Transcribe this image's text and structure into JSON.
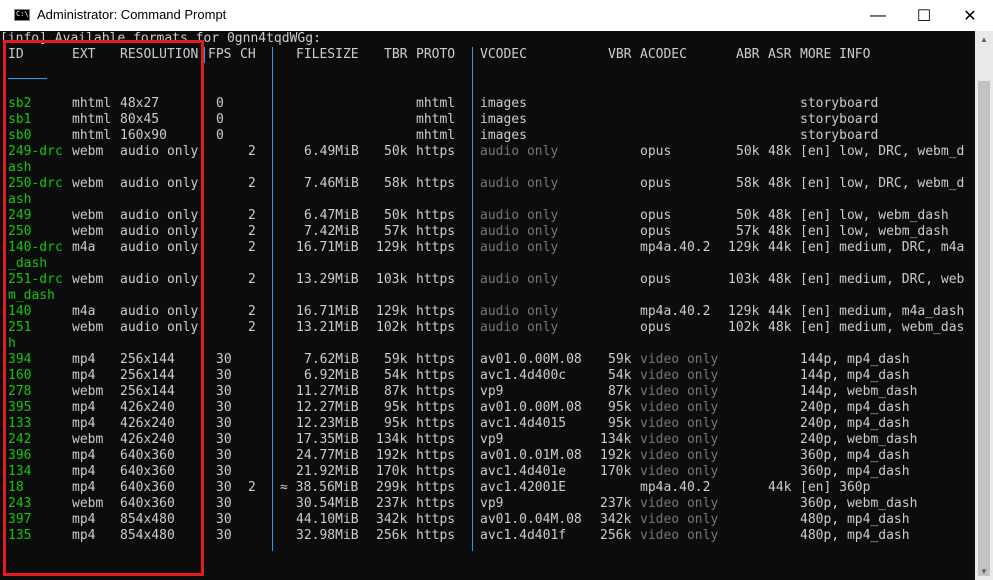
{
  "window": {
    "title": "Administrator: Command Prompt",
    "icon_label": "C:\\",
    "minimize": "—",
    "maximize": "☐",
    "close": "✕"
  },
  "console": {
    "info_line": "[info] Available formats for 0gnn4tqdWGg:",
    "headers": {
      "id": "ID",
      "ext": "EXT",
      "resolution": "RESOLUTION",
      "fps": "FPS",
      "ch": "CH",
      "filesize": "FILESIZE",
      "tbr": "TBR",
      "proto": "PROTO",
      "vcodec": "VCODEC",
      "vbr": "VBR",
      "acodec": "ACODEC",
      "abr": "ABR",
      "asr": "ASR",
      "more_info": "MORE INFO"
    },
    "dash_line": "─────",
    "rows": [
      {
        "id": "sb2",
        "ext": "mhtml",
        "res": "48x27",
        "fps": "0",
        "ch": "",
        "size": "",
        "tbr": "",
        "proto": "mhtml",
        "vcodec": "images",
        "vbr": "",
        "acodec": "",
        "abr": "",
        "asr": "",
        "more": "storyboard",
        "wrap": ""
      },
      {
        "id": "sb1",
        "ext": "mhtml",
        "res": "80x45",
        "fps": "0",
        "ch": "",
        "size": "",
        "tbr": "",
        "proto": "mhtml",
        "vcodec": "images",
        "vbr": "",
        "acodec": "",
        "abr": "",
        "asr": "",
        "more": "storyboard",
        "wrap": ""
      },
      {
        "id": "sb0",
        "ext": "mhtml",
        "res": "160x90",
        "fps": "0",
        "ch": "",
        "size": "",
        "tbr": "",
        "proto": "mhtml",
        "vcodec": "images",
        "vbr": "",
        "acodec": "",
        "abr": "",
        "asr": "",
        "more": "storyboard",
        "wrap": ""
      },
      {
        "id": "249-drc",
        "ext": "webm",
        "res": "audio only",
        "fps": "",
        "ch": "2",
        "size": "6.49MiB",
        "tbr": "50k",
        "proto": "https",
        "vcodec": "audio only",
        "vbr": "",
        "acodec": "opus",
        "abr": "50k",
        "asr": "48k",
        "more": "[en] low, DRC, webm_d",
        "wrap": "ash"
      },
      {
        "id": "250-drc",
        "ext": "webm",
        "res": "audio only",
        "fps": "",
        "ch": "2",
        "size": "7.46MiB",
        "tbr": "58k",
        "proto": "https",
        "vcodec": "audio only",
        "vbr": "",
        "acodec": "opus",
        "abr": "58k",
        "asr": "48k",
        "more": "[en] low, DRC, webm_d",
        "wrap": "ash"
      },
      {
        "id": "249",
        "ext": "webm",
        "res": "audio only",
        "fps": "",
        "ch": "2",
        "size": "6.47MiB",
        "tbr": "50k",
        "proto": "https",
        "vcodec": "audio only",
        "vbr": "",
        "acodec": "opus",
        "abr": "50k",
        "asr": "48k",
        "more": "[en] low, webm_dash",
        "wrap": ""
      },
      {
        "id": "250",
        "ext": "webm",
        "res": "audio only",
        "fps": "",
        "ch": "2",
        "size": "7.42MiB",
        "tbr": "57k",
        "proto": "https",
        "vcodec": "audio only",
        "vbr": "",
        "acodec": "opus",
        "abr": "57k",
        "asr": "48k",
        "more": "[en] low, webm_dash",
        "wrap": ""
      },
      {
        "id": "140-drc",
        "ext": "m4a",
        "res": "audio only",
        "fps": "",
        "ch": "2",
        "size": "16.71MiB",
        "tbr": "129k",
        "proto": "https",
        "vcodec": "audio only",
        "vbr": "",
        "acodec": "mp4a.40.2",
        "abr": "129k",
        "asr": "44k",
        "more": "[en] medium, DRC, m4a",
        "wrap": "_dash"
      },
      {
        "id": "251-drc",
        "ext": "webm",
        "res": "audio only",
        "fps": "",
        "ch": "2",
        "size": "13.29MiB",
        "tbr": "103k",
        "proto": "https",
        "vcodec": "audio only",
        "vbr": "",
        "acodec": "opus",
        "abr": "103k",
        "asr": "48k",
        "more": "[en] medium, DRC, web",
        "wrap": "m_dash"
      },
      {
        "id": "140",
        "ext": "m4a",
        "res": "audio only",
        "fps": "",
        "ch": "2",
        "size": "16.71MiB",
        "tbr": "129k",
        "proto": "https",
        "vcodec": "audio only",
        "vbr": "",
        "acodec": "mp4a.40.2",
        "abr": "129k",
        "asr": "44k",
        "more": "[en] medium, m4a_dash",
        "wrap": ""
      },
      {
        "id": "251",
        "ext": "webm",
        "res": "audio only",
        "fps": "",
        "ch": "2",
        "size": "13.21MiB",
        "tbr": "102k",
        "proto": "https",
        "vcodec": "audio only",
        "vbr": "",
        "acodec": "opus",
        "abr": "102k",
        "asr": "48k",
        "more": "[en] medium, webm_das",
        "wrap": "h"
      },
      {
        "id": "394",
        "ext": "mp4",
        "res": "256x144",
        "fps": "30",
        "ch": "",
        "size": "7.62MiB",
        "tbr": "59k",
        "proto": "https",
        "vcodec": "av01.0.00M.08",
        "vbr": "59k",
        "acodec": "video only",
        "abr": "",
        "asr": "",
        "more": "144p, mp4_dash",
        "wrap": ""
      },
      {
        "id": "160",
        "ext": "mp4",
        "res": "256x144",
        "fps": "30",
        "ch": "",
        "size": "6.92MiB",
        "tbr": "54k",
        "proto": "https",
        "vcodec": "avc1.4d400c",
        "vbr": "54k",
        "acodec": "video only",
        "abr": "",
        "asr": "",
        "more": "144p, mp4_dash",
        "wrap": ""
      },
      {
        "id": "278",
        "ext": "webm",
        "res": "256x144",
        "fps": "30",
        "ch": "",
        "size": "11.27MiB",
        "tbr": "87k",
        "proto": "https",
        "vcodec": "vp9",
        "vbr": "87k",
        "acodec": "video only",
        "abr": "",
        "asr": "",
        "more": "144p, webm_dash",
        "wrap": ""
      },
      {
        "id": "395",
        "ext": "mp4",
        "res": "426x240",
        "fps": "30",
        "ch": "",
        "size": "12.27MiB",
        "tbr": "95k",
        "proto": "https",
        "vcodec": "av01.0.00M.08",
        "vbr": "95k",
        "acodec": "video only",
        "abr": "",
        "asr": "",
        "more": "240p, mp4_dash",
        "wrap": ""
      },
      {
        "id": "133",
        "ext": "mp4",
        "res": "426x240",
        "fps": "30",
        "ch": "",
        "size": "12.23MiB",
        "tbr": "95k",
        "proto": "https",
        "vcodec": "avc1.4d4015",
        "vbr": "95k",
        "acodec": "video only",
        "abr": "",
        "asr": "",
        "more": "240p, mp4_dash",
        "wrap": ""
      },
      {
        "id": "242",
        "ext": "webm",
        "res": "426x240",
        "fps": "30",
        "ch": "",
        "size": "17.35MiB",
        "tbr": "134k",
        "proto": "https",
        "vcodec": "vp9",
        "vbr": "134k",
        "acodec": "video only",
        "abr": "",
        "asr": "",
        "more": "240p, webm_dash",
        "wrap": ""
      },
      {
        "id": "396",
        "ext": "mp4",
        "res": "640x360",
        "fps": "30",
        "ch": "",
        "size": "24.77MiB",
        "tbr": "192k",
        "proto": "https",
        "vcodec": "av01.0.01M.08",
        "vbr": "192k",
        "acodec": "video only",
        "abr": "",
        "asr": "",
        "more": "360p, mp4_dash",
        "wrap": ""
      },
      {
        "id": "134",
        "ext": "mp4",
        "res": "640x360",
        "fps": "30",
        "ch": "",
        "size": "21.92MiB",
        "tbr": "170k",
        "proto": "https",
        "vcodec": "avc1.4d401e",
        "vbr": "170k",
        "acodec": "video only",
        "abr": "",
        "asr": "",
        "more": "360p, mp4_dash",
        "wrap": ""
      },
      {
        "id": "18",
        "ext": "mp4",
        "res": "640x360",
        "fps": "30",
        "ch": "2",
        "size": "≈ 38.56MiB",
        "tbr": "299k",
        "proto": "https",
        "vcodec": "avc1.42001E",
        "vbr": "",
        "acodec": "mp4a.40.2",
        "abr": "",
        "asr": "44k",
        "more": "[en] 360p",
        "wrap": ""
      },
      {
        "id": "243",
        "ext": "webm",
        "res": "640x360",
        "fps": "30",
        "ch": "",
        "size": "30.54MiB",
        "tbr": "237k",
        "proto": "https",
        "vcodec": "vp9",
        "vbr": "237k",
        "acodec": "video only",
        "abr": "",
        "asr": "",
        "more": "360p, webm_dash",
        "wrap": ""
      },
      {
        "id": "397",
        "ext": "mp4",
        "res": "854x480",
        "fps": "30",
        "ch": "",
        "size": "44.10MiB",
        "tbr": "342k",
        "proto": "https",
        "vcodec": "av01.0.04M.08",
        "vbr": "342k",
        "acodec": "video only",
        "abr": "",
        "asr": "",
        "more": "480p, mp4_dash",
        "wrap": ""
      },
      {
        "id": "135",
        "ext": "mp4",
        "res": "854x480",
        "fps": "30",
        "ch": "",
        "size": "32.98MiB",
        "tbr": "256k",
        "proto": "https",
        "vcodec": "avc1.4d401f",
        "vbr": "256k",
        "acodec": "video only",
        "abr": "",
        "asr": "",
        "more": "480p, mp4_dash",
        "wrap": ""
      }
    ]
  },
  "annotation": {
    "color": "#e21d1d"
  },
  "colors": {
    "id_green": "#16c60c",
    "separator_blue": "#3a96dd",
    "dim_gray": "#767676",
    "text": "#cccccc"
  }
}
